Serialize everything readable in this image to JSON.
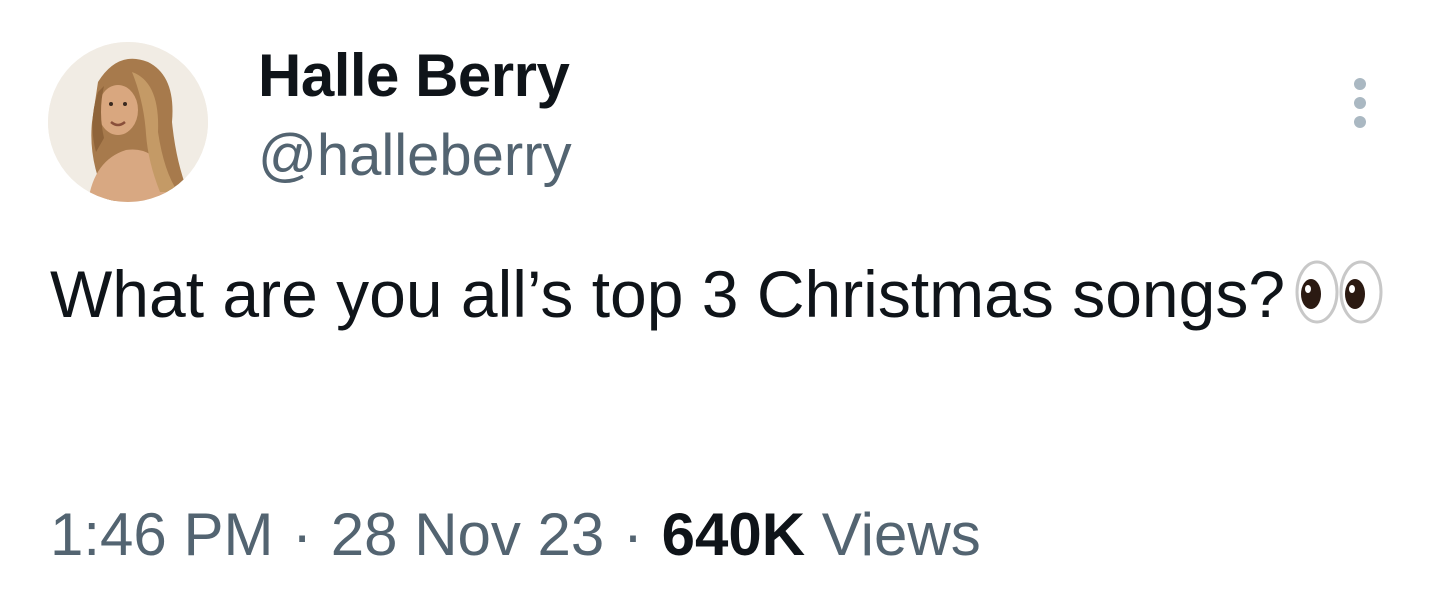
{
  "author": {
    "display_name": "Halle Berry",
    "handle": "@halleberry"
  },
  "tweet": {
    "text": "What are you all’s top 3 Christmas songs?",
    "emoji_icon": "eyes-emoji"
  },
  "meta": {
    "time": "1:46 PM",
    "separator": "·",
    "date": "28 Nov 23",
    "views_count": "640K",
    "views_label": "Views"
  },
  "icons": {
    "more": "more-options-icon"
  },
  "colors": {
    "primary_text": "#0f1419",
    "secondary_text": "#536471",
    "more_icon": "#aab8c2"
  }
}
